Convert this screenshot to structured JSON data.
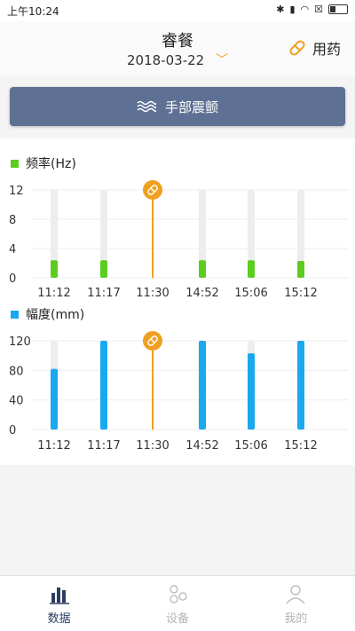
{
  "status_bar": {
    "time": "上午10:24",
    "icons": [
      "bluetooth-icon",
      "signal-icon",
      "wifi-icon",
      "notification-icon",
      "battery-icon"
    ]
  },
  "header": {
    "meal": "睿餐",
    "date": "2018-03-22",
    "medication_label": "用药"
  },
  "tremor_button": {
    "label": "手部震颤"
  },
  "colors": {
    "frequency": "#5ccc1e",
    "amplitude": "#1aa8ee",
    "medication_marker": "#f0a020",
    "track": "#ededed",
    "header_bar": "#5e7194",
    "active_tab": "#2c3e60"
  },
  "chart_data": [
    {
      "type": "bar",
      "title": "频率(Hz)",
      "categories": [
        "11:12",
        "11:17",
        "11:30",
        "14:52",
        "15:06",
        "15:12"
      ],
      "values": [
        2.4,
        2.4,
        null,
        2.4,
        2.4,
        2.3
      ],
      "ylim": [
        0,
        12
      ],
      "yticks": [
        0,
        4,
        8,
        12
      ],
      "medication_marker_at": "11:30",
      "grid": true
    },
    {
      "type": "bar",
      "title": "幅度(mm)",
      "categories": [
        "11:12",
        "11:17",
        "11:30",
        "14:52",
        "15:06",
        "15:12"
      ],
      "values": [
        82,
        120,
        null,
        120,
        103,
        120
      ],
      "ylim": [
        0,
        120
      ],
      "yticks": [
        0,
        40,
        80,
        120
      ],
      "medication_marker_at": "11:30",
      "grid": true
    }
  ],
  "tabs": [
    {
      "label": "数据",
      "icon": "bar-chart-icon",
      "active": true
    },
    {
      "label": "设备",
      "icon": "device-icon",
      "active": false
    },
    {
      "label": "我的",
      "icon": "profile-icon",
      "active": false
    }
  ]
}
